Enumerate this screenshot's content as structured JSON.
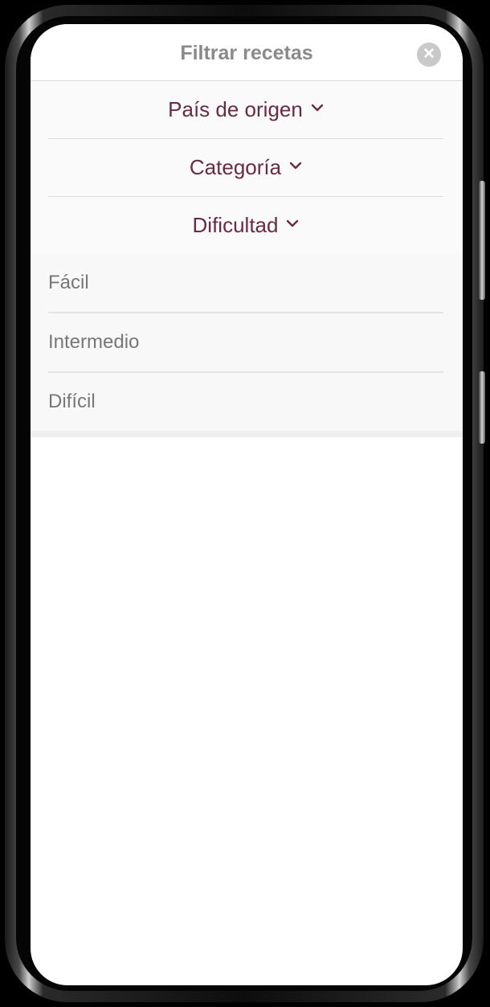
{
  "modal": {
    "title": "Filtrar recetas",
    "close_icon": "close-icon"
  },
  "filters": [
    {
      "label": "País de origen",
      "icon": "chevron-down-icon",
      "expanded": false
    },
    {
      "label": "Categoría",
      "icon": "chevron-down-icon",
      "expanded": false
    },
    {
      "label": "Dificultad",
      "icon": "chevron-down-icon",
      "expanded": true
    }
  ],
  "difficulty_options": [
    {
      "label": "Fácil"
    },
    {
      "label": "Intermedio"
    },
    {
      "label": "Difícil"
    }
  ],
  "colors": {
    "accent": "#6a2a43",
    "title_gray": "#8a8a8a",
    "option_text": "#777777"
  }
}
